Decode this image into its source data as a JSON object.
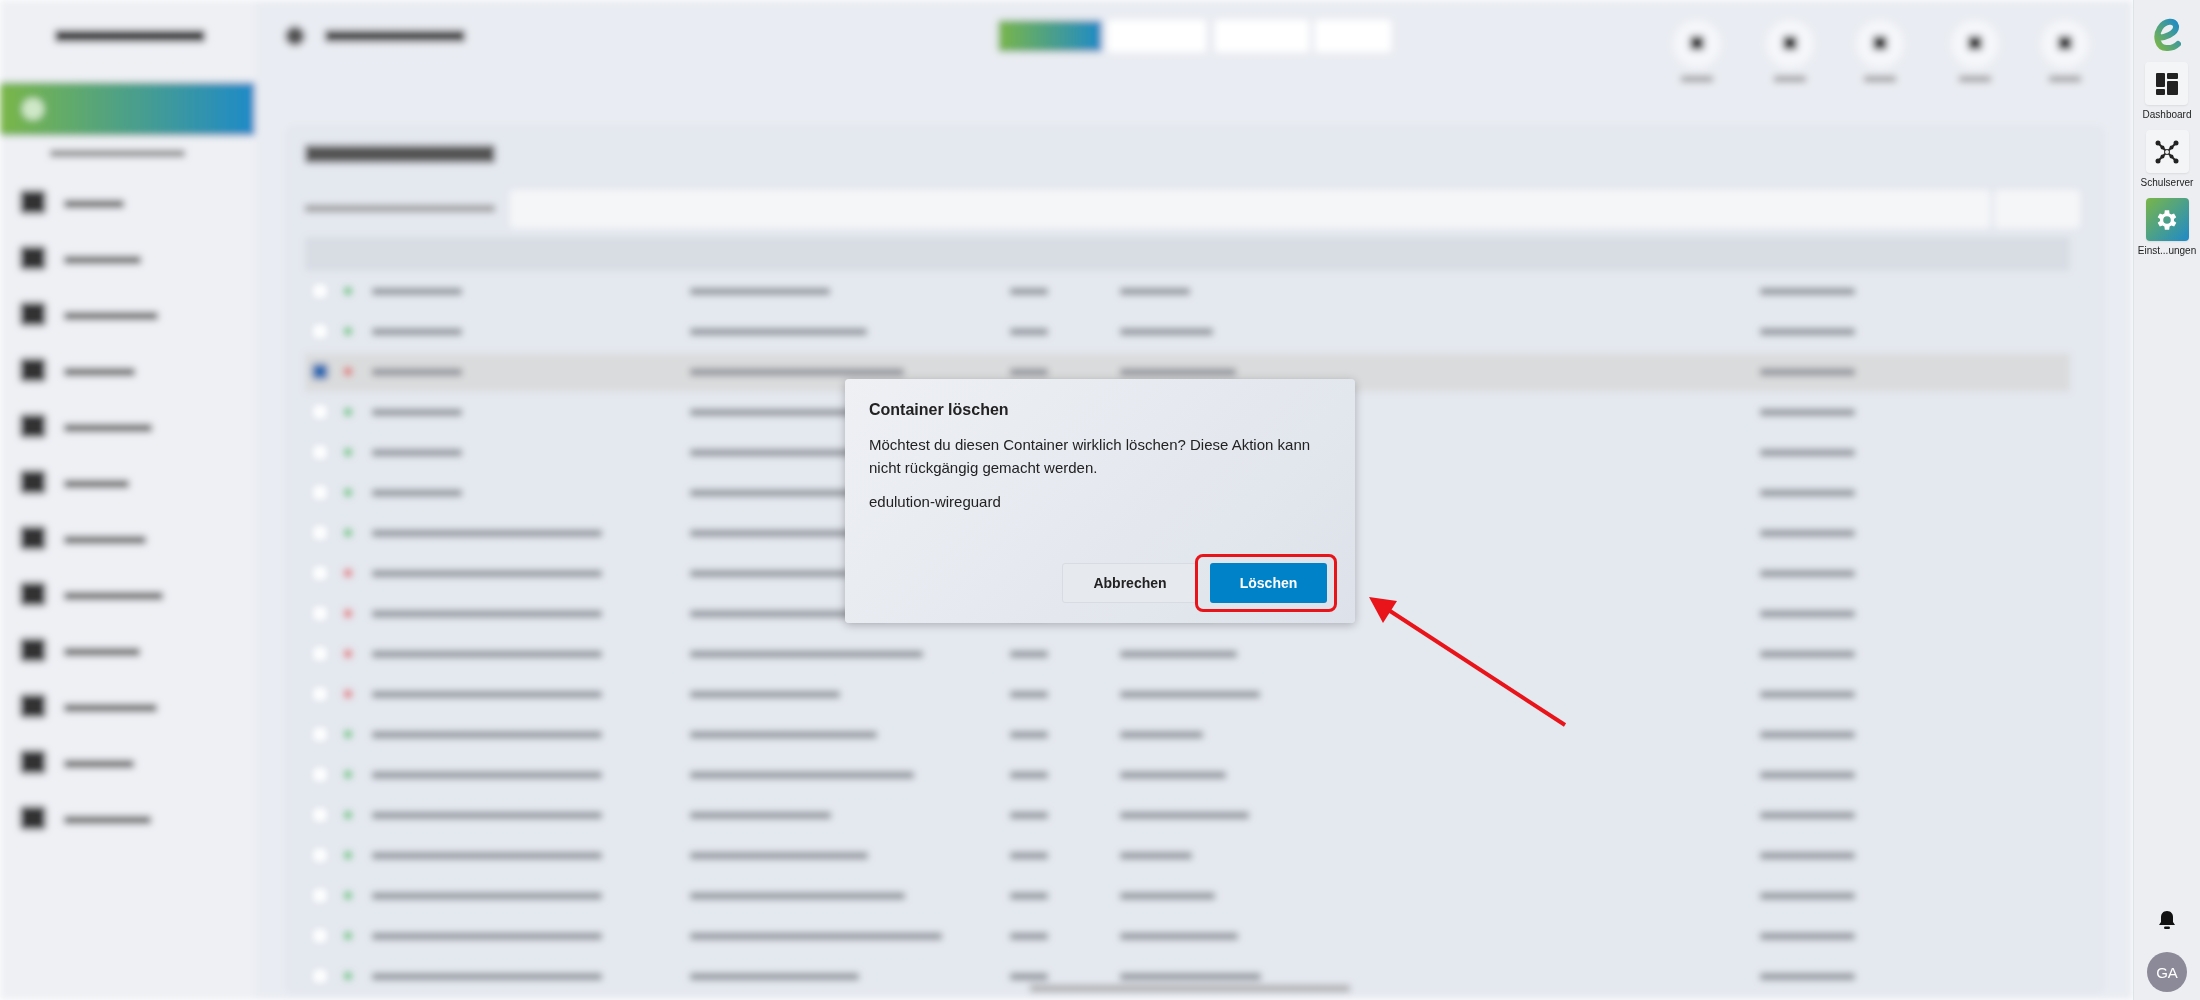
{
  "dialog": {
    "title": "Container löschen",
    "message": "Möchtest du diesen Container wirklich löschen? Diese Aktion kann nicht rückgängig gemacht werden.",
    "container_name": "edulution-wireguard",
    "buttons": [
      {
        "label": "Abbrechen",
        "kind": "secondary"
      },
      {
        "label": "Löschen",
        "kind": "primary"
      }
    ]
  },
  "app_bar": {
    "items": [
      {
        "label": "Dashboard",
        "kind": "dashboard",
        "selected": false
      },
      {
        "label": "Schulserver",
        "kind": "server",
        "selected": false
      },
      {
        "label": "Einst...ungen",
        "kind": "settings",
        "selected": true
      }
    ],
    "avatar": "GA"
  }
}
